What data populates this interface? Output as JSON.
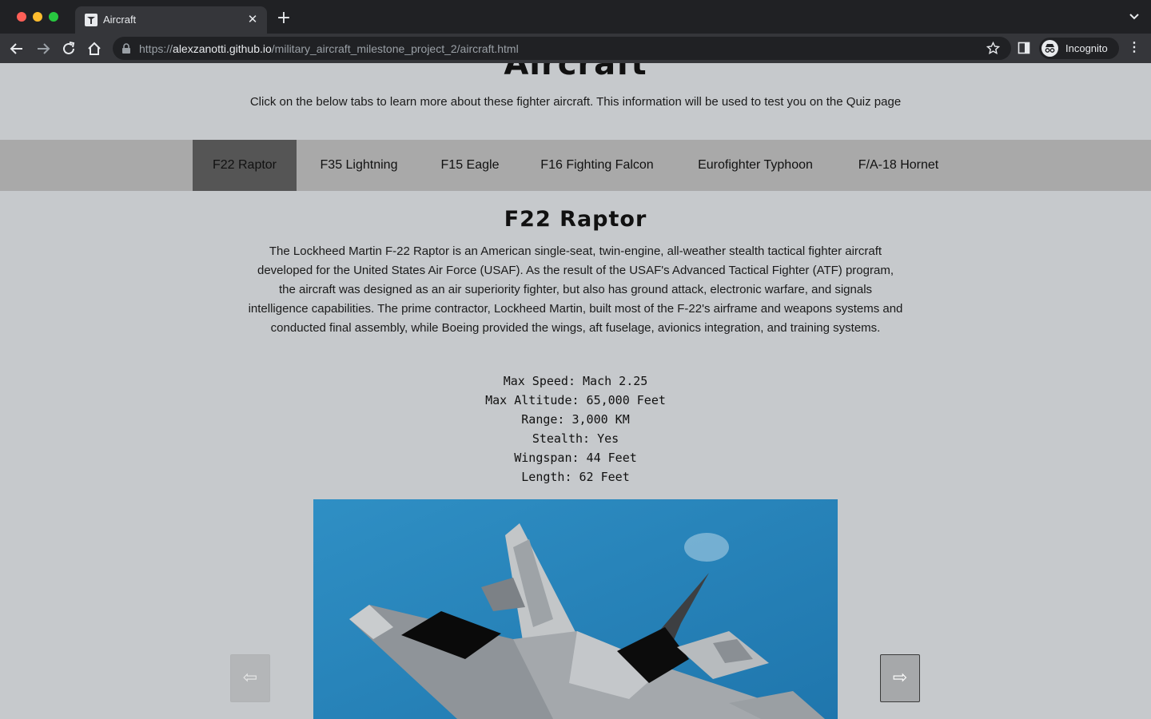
{
  "browser": {
    "tab_title": "Aircraft",
    "url_prefix": "https://",
    "url_host": "alexzanotti.github.io",
    "url_path": "/military_aircraft_milestone_project_2/aircraft.html",
    "profile_label": "Incognito"
  },
  "page": {
    "heading": "Aircraft",
    "intro": "Click on the below tabs to learn more about these fighter aircraft. This information will be used to test you on the Quiz page"
  },
  "aircraft_tabs": [
    {
      "label": "F22 Raptor",
      "active": true
    },
    {
      "label": "F35 Lightning",
      "active": false
    },
    {
      "label": "F15 Eagle",
      "active": false
    },
    {
      "label": "F16 Fighting Falcon",
      "active": false
    },
    {
      "label": "Eurofighter Typhoon",
      "active": false
    },
    {
      "label": "F/A-18 Hornet",
      "active": false
    }
  ],
  "selected": {
    "title": "F22 Raptor",
    "description": "The Lockheed Martin F-22 Raptor is an American single-seat, twin-engine, all-weather stealth tactical fighter aircraft developed for the United States Air Force (USAF). As the result of the USAF's Advanced Tactical Fighter (ATF) program, the aircraft was designed as an air superiority fighter, but also has ground attack, electronic warfare, and signals intelligence capabilities. The prime contractor, Lockheed Martin, built most of the F-22's airframe and weapons systems and conducted final assembly, while Boeing provided the wings, aft fuselage, avionics integration, and training systems.",
    "specs": [
      "Max Speed: Mach 2.25",
      "Max Altitude: 65,000 Feet",
      "Range: 3,000 KM",
      "Stealth: Yes",
      "Wingspan: 44 Feet",
      "Length: 62 Feet"
    ]
  },
  "carousel": {
    "prev_glyph": "⇦",
    "next_glyph": "⇨"
  },
  "colors": {
    "page_bg": "#c6c9cc",
    "tabs_bar": "#a9a9a9",
    "active_tab": "#555555",
    "sky": "#2a86bb"
  }
}
